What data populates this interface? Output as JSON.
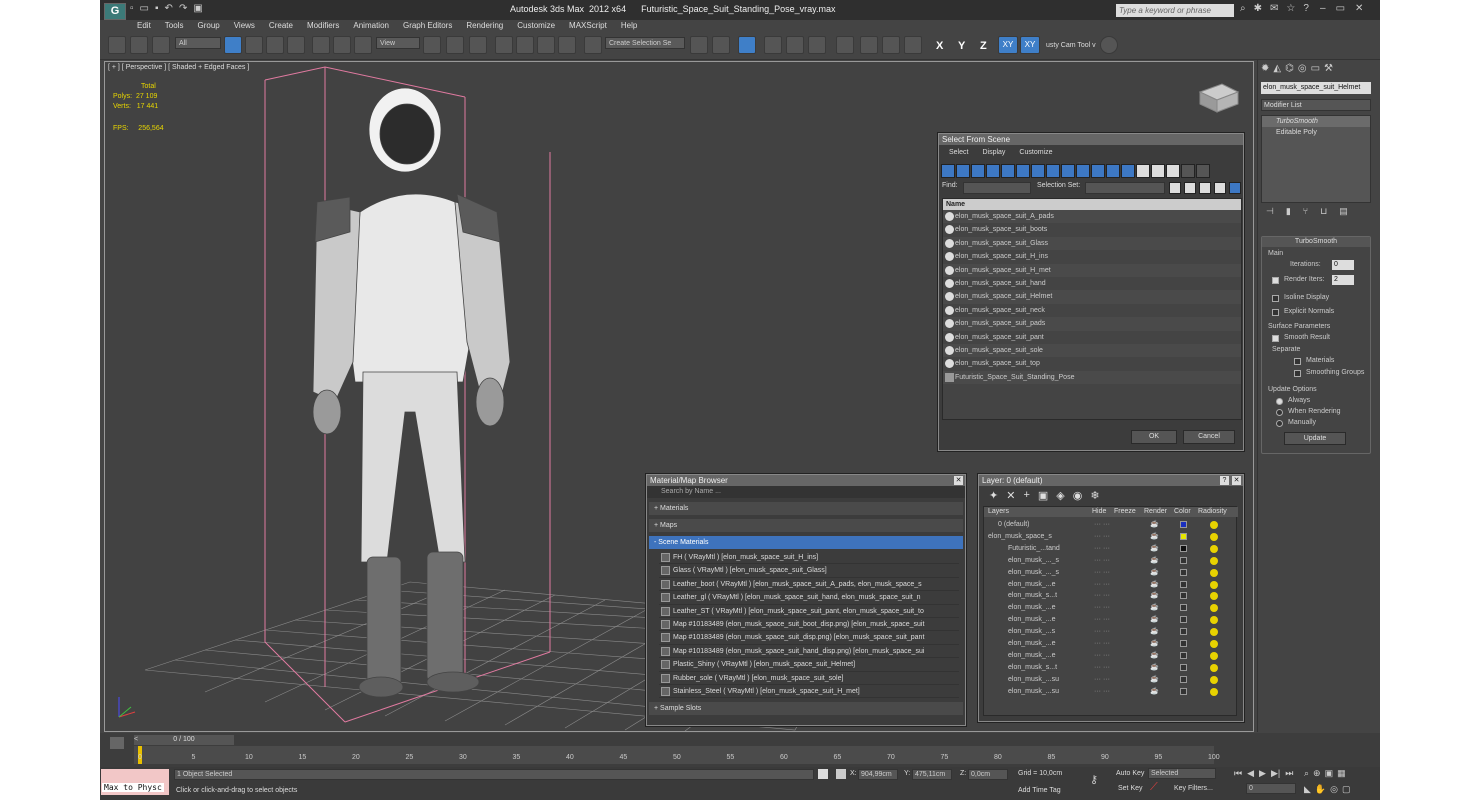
{
  "app": {
    "title": "Autodesk 3ds Max  2012 x64      Futuristic_Space_Suit_Standing_Pose_vray.max",
    "icon_letter": "G",
    "search_placeholder": "Type a keyword or phrase"
  },
  "menu": [
    "Edit",
    "Tools",
    "Group",
    "Views",
    "Create",
    "Modifiers",
    "Animation",
    "Graph Editors",
    "Rendering",
    "Customize",
    "MAXScript",
    "Help"
  ],
  "toolbar": {
    "selection_filter": "All",
    "ref_coord": "View",
    "named_selection": "Create Selection Se",
    "axes": [
      "X",
      "Y",
      "Z",
      "XY",
      "XY"
    ],
    "camera_tool": "usty Cam Tool v"
  },
  "viewport": {
    "label": "[ + ] [ Perspective ] [ Shaded + Edged Faces ]",
    "stats": {
      "total_label": "Total",
      "polys_label": "Polys:",
      "polys": "27 109",
      "verts_label": "Verts:",
      "verts": "17 441",
      "fps_label": "FPS:",
      "fps": "256,564"
    }
  },
  "select_from_scene": {
    "title": "Select From Scene",
    "menu": [
      "Select",
      "Display",
      "Customize"
    ],
    "find_label": "Find:",
    "selection_set_label": "Selection Set:",
    "column_name": "Name",
    "objects": [
      "elon_musk_space_suit_A_pads",
      "elon_musk_space_suit_boots",
      "elon_musk_space_suit_Glass",
      "elon_musk_space_suit_H_ins",
      "elon_musk_space_suit_H_met",
      "elon_musk_space_suit_hand",
      "elon_musk_space_suit_Helmet",
      "elon_musk_space_suit_neck",
      "elon_musk_space_suit_pads",
      "elon_musk_space_suit_pant",
      "elon_musk_space_suit_sole",
      "elon_musk_space_suit_top",
      "Futuristic_Space_Suit_Standing_Pose"
    ],
    "ok_label": "OK",
    "cancel_label": "Cancel"
  },
  "material_browser": {
    "title": "Material/Map Browser",
    "search_placeholder": "Search by Name ...",
    "groups": {
      "materials": "+ Materials",
      "maps": "+ Maps",
      "scene_materials": "- Scene Materials",
      "sample_slots": "+ Sample Slots"
    },
    "scene_materials": [
      "FH  ( VRayMtl )  [elon_musk_space_suit_H_ins]",
      "Glass  ( VRayMtl )  [elon_musk_space_suit_Glass]",
      "Leather_boot  ( VRayMtl )  [elon_musk_space_suit_A_pads, elon_musk_space_s",
      "Leather_gl  ( VRayMtl )  [elon_musk_space_suit_hand, elon_musk_space_suit_n",
      "Leather_ST  ( VRayMtl )  [elon_musk_space_suit_pant, elon_musk_space_suit_to",
      "Map #10183489 (elon_musk_space_suit_boot_disp.png) [elon_musk_space_suit",
      "Map #10183489 (elon_musk_space_suit_disp.png) [elon_musk_space_suit_pant",
      "Map #10183489 (elon_musk_space_suit_hand_disp.png) [elon_musk_space_sui",
      "Plastic_Shiny  ( VRayMtl )  [elon_musk_space_suit_Helmet]",
      "Rubber_sole  ( VRayMtl )  [elon_musk_space_suit_sole]",
      "Stainless_Steel  ( VRayMtl )  [elon_musk_space_suit_H_met]"
    ]
  },
  "layer_manager": {
    "title": "Layer: 0 (default)",
    "columns": [
      "Layers",
      "Hide",
      "Freeze",
      "Render",
      "Color",
      "Radiosity"
    ],
    "rows": [
      {
        "name": "0 (default)",
        "indent": 1,
        "color": "#1a2fbf"
      },
      {
        "name": "elon_musk_space_s",
        "indent": 0,
        "color": "#e6e600"
      },
      {
        "name": "Futuristic_...tand",
        "indent": 2,
        "color": "#111111"
      },
      {
        "name": "elon_musk_..._s",
        "indent": 2,
        "color": "#333333"
      },
      {
        "name": "elon_musk_..._s",
        "indent": 2,
        "color": "#333333"
      },
      {
        "name": "elon_musk_...e",
        "indent": 2,
        "color": "#333333"
      },
      {
        "name": "elon_musk_s...t",
        "indent": 2,
        "color": "#333333"
      },
      {
        "name": "elon_musk_...e",
        "indent": 2,
        "color": "#333333"
      },
      {
        "name": "elon_musk_...e",
        "indent": 2,
        "color": "#333333"
      },
      {
        "name": "elon_musk_...s",
        "indent": 2,
        "color": "#333333"
      },
      {
        "name": "elon_musk_...e",
        "indent": 2,
        "color": "#333333"
      },
      {
        "name": "elon_musk_...e",
        "indent": 2,
        "color": "#333333"
      },
      {
        "name": "elon_musk_s...t",
        "indent": 2,
        "color": "#333333"
      },
      {
        "name": "elon_musk_...su",
        "indent": 2,
        "color": "#333333"
      },
      {
        "name": "elon_musk_...su",
        "indent": 2,
        "color": "#333333"
      }
    ]
  },
  "command_panel": {
    "object_name": "elon_musk_space_suit_Helmet",
    "modifier_list": "Modifier List",
    "stack": [
      "TurboSmooth",
      "Editable Poly"
    ],
    "turbosmooth": {
      "title": "TurboSmooth",
      "main": "Main",
      "iterations_label": "Iterations:",
      "iterations": "0",
      "render_iters_label": "Render Iters:",
      "render_iters": "2",
      "isoline": "Isoline Display",
      "explicit": "Explicit Normals",
      "surface_params": "Surface Parameters",
      "smooth_result": "Smooth Result",
      "separate": "Separate",
      "materials": "Materials",
      "smoothing_groups": "Smoothing Groups",
      "update_options": "Update Options",
      "always": "Always",
      "when_rendering": "When Rendering",
      "manually": "Manually",
      "update": "Update"
    }
  },
  "timeline": {
    "frame": "0 / 100",
    "ticks": [
      "0",
      "5",
      "10",
      "15",
      "20",
      "25",
      "30",
      "35",
      "40",
      "45",
      "50",
      "55",
      "60",
      "65",
      "70",
      "75",
      "80",
      "85",
      "90",
      "95",
      "100"
    ]
  },
  "status": {
    "maxscript_label": "Max to Physc",
    "selected": "1 Object Selected",
    "prompt": "Click or click-and-drag to select objects",
    "x_label": "X:",
    "x": "904,99cm",
    "y_label": "Y:",
    "y": "475,11cm",
    "z_label": "Z:",
    "z": "0,0cm",
    "grid": "Grid = 10,0cm",
    "add_time_tag": "Add Time Tag",
    "auto_key": "Auto Key",
    "set_key": "Set Key",
    "selected_dd": "Selected",
    "key_filters": "Key Filters...",
    "frame_field": "0"
  }
}
